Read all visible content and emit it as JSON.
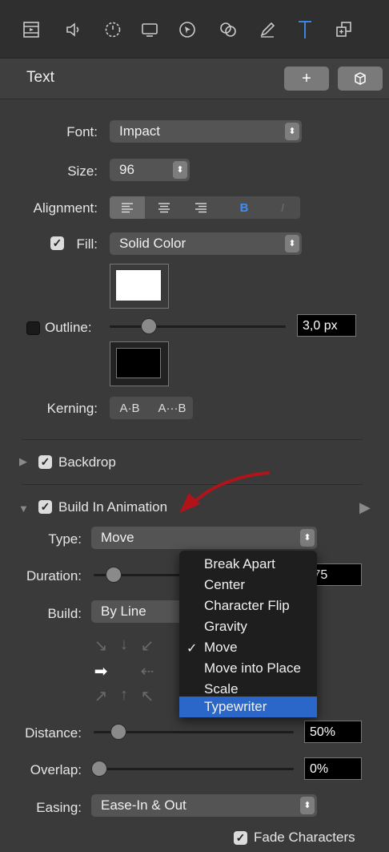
{
  "toolbar": {
    "icons": [
      "film-icon",
      "speaker-icon",
      "dial-icon",
      "screen-icon",
      "cursor-icon",
      "circles-icon",
      "pen-icon",
      "text-icon",
      "layers-icon"
    ],
    "active": "text-icon"
  },
  "header": {
    "title": "Text",
    "add_label": "+",
    "box_label": "⬡"
  },
  "font": {
    "label": "Font:",
    "value": "Impact"
  },
  "size": {
    "label": "Size:",
    "value": "96"
  },
  "alignment": {
    "label": "Alignment:",
    "bold": "B",
    "italic": "I"
  },
  "fill": {
    "label": "Fill:",
    "value": "Solid Color",
    "checked": true,
    "color": "#ffffff"
  },
  "outline": {
    "label": "Outline:",
    "value": "3,0 px",
    "checked": false,
    "color": "#000000"
  },
  "kerning": {
    "label": "Kerning:",
    "tighter": "A·B",
    "looser": "A···B"
  },
  "backdrop": {
    "label": "Backdrop",
    "checked": true
  },
  "build_in": {
    "label": "Build In Animation",
    "checked": true
  },
  "type": {
    "label": "Type:",
    "value": "Move"
  },
  "duration": {
    "label": "Duration:",
    "value": ",75"
  },
  "build": {
    "label": "Build:",
    "value": "By Line"
  },
  "distance": {
    "label": "Distance:",
    "value": "50%"
  },
  "overlap": {
    "label": "Overlap:",
    "value": "0%"
  },
  "easing": {
    "label": "Easing:",
    "value": "Ease-In & Out"
  },
  "fade_characters": {
    "label": "Fade Characters",
    "checked": true
  },
  "type_menu": {
    "items": [
      "Break Apart",
      "Center",
      "Character Flip",
      "Gravity",
      "Move",
      "Move into Place",
      "Scale",
      "Typewriter"
    ],
    "checked": "Move",
    "highlighted": "Typewriter"
  },
  "colors": {
    "accent": "#3d8ef0",
    "highlight": "#2a67c9",
    "annotation_arrow": "#b0141a"
  }
}
